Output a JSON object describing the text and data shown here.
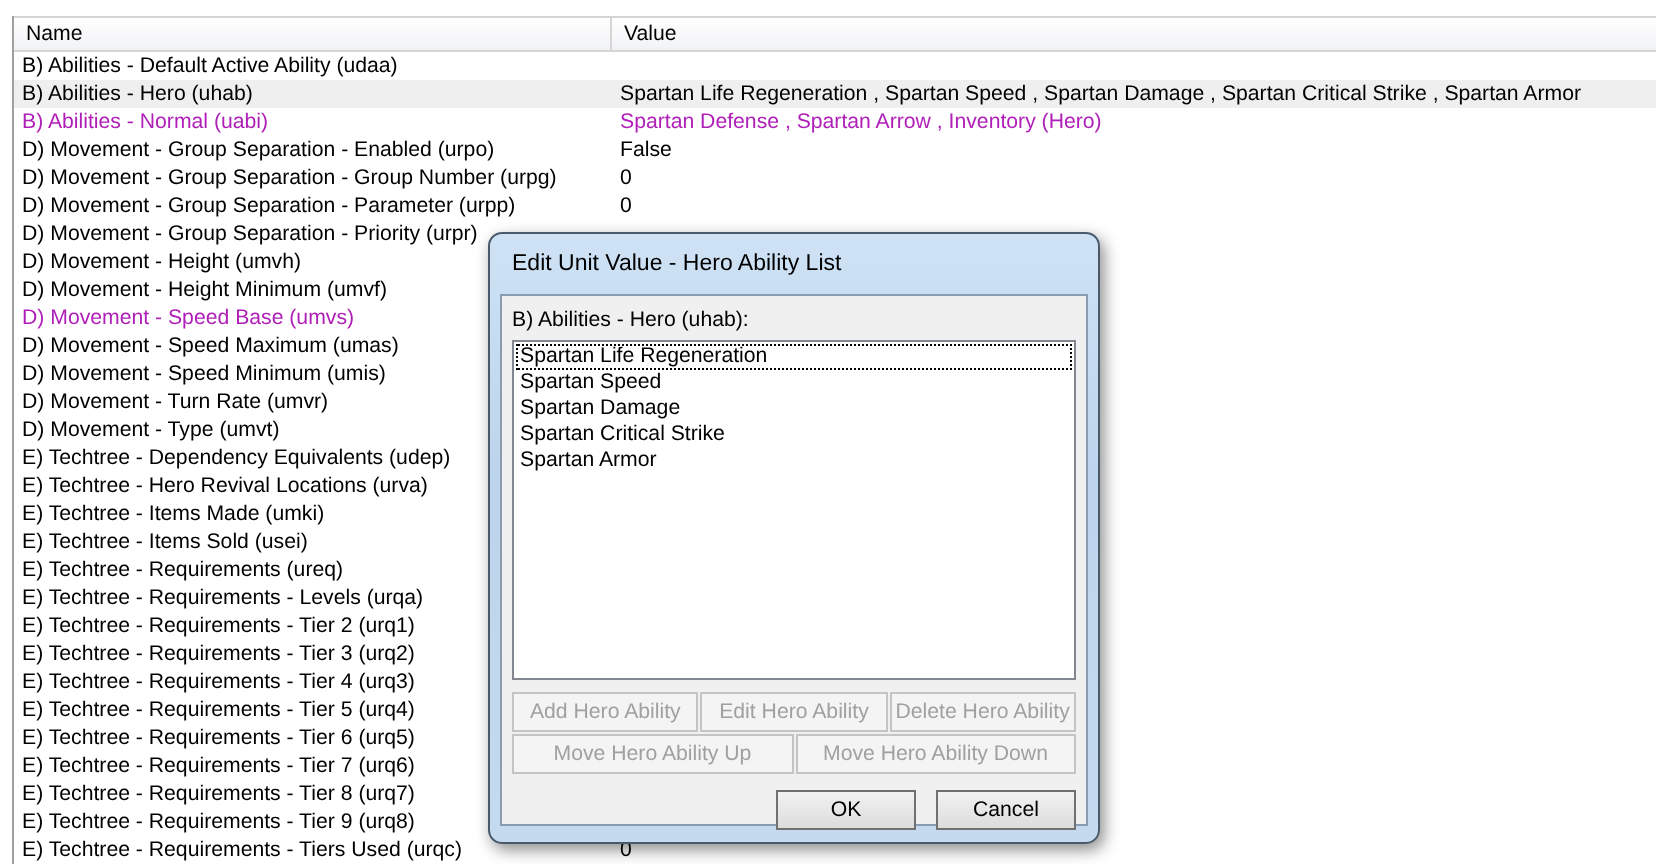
{
  "table": {
    "columns": [
      "Name",
      "Value"
    ],
    "rows": [
      {
        "name": "B) Abilities - Default Active Ability (udaa)",
        "selected": false,
        "modified": false
      },
      {
        "name": "B) Abilities - Hero (uhab)",
        "value": "Spartan Life Regeneration , Spartan Speed , Spartan Damage , Spartan Critical Strike , Spartan Armor",
        "selected": true,
        "modified": false
      },
      {
        "name": "B) Abilities - Normal (uabi)",
        "value": "Spartan Defense , Spartan Arrow , Inventory (Hero)",
        "selected": false,
        "modified": true
      },
      {
        "name": "D) Movement - Group Separation - Enabled (urpo)",
        "value": "False",
        "selected": false,
        "modified": false
      },
      {
        "name": "D) Movement - Group Separation - Group Number (urpg)",
        "value": "0",
        "selected": false,
        "modified": false
      },
      {
        "name": "D) Movement - Group Separation - Parameter (urpp)",
        "value": "0",
        "selected": false,
        "modified": false
      },
      {
        "name": "D) Movement - Group Separation - Priority (urpr)",
        "selected": false,
        "modified": false
      },
      {
        "name": "D) Movement - Height (umvh)",
        "selected": false,
        "modified": false
      },
      {
        "name": "D) Movement - Height Minimum (umvf)",
        "selected": false,
        "modified": false
      },
      {
        "name": "D) Movement - Speed Base (umvs)",
        "selected": false,
        "modified": true
      },
      {
        "name": "D) Movement - Speed Maximum (umas)",
        "selected": false,
        "modified": false
      },
      {
        "name": "D) Movement - Speed Minimum (umis)",
        "selected": false,
        "modified": false
      },
      {
        "name": "D) Movement - Turn Rate (umvr)",
        "selected": false,
        "modified": false
      },
      {
        "name": "D) Movement - Type (umvt)",
        "selected": false,
        "modified": false
      },
      {
        "name": "E) Techtree - Dependency Equivalents (udep)",
        "selected": false,
        "modified": false
      },
      {
        "name": "E) Techtree - Hero Revival Locations (urva)",
        "selected": false,
        "modified": false
      },
      {
        "name": "E) Techtree - Items Made (umki)",
        "selected": false,
        "modified": false
      },
      {
        "name": "E) Techtree - Items Sold (usei)",
        "selected": false,
        "modified": false
      },
      {
        "name": "E) Techtree - Requirements (ureq)",
        "selected": false,
        "modified": false
      },
      {
        "name": "E) Techtree - Requirements - Levels (urqa)",
        "selected": false,
        "modified": false
      },
      {
        "name": "E) Techtree - Requirements - Tier 2 (urq1)",
        "selected": false,
        "modified": false
      },
      {
        "name": "E) Techtree - Requirements - Tier 3 (urq2)",
        "selected": false,
        "modified": false
      },
      {
        "name": "E) Techtree - Requirements - Tier 4 (urq3)",
        "selected": false,
        "modified": false
      },
      {
        "name": "E) Techtree - Requirements - Tier 5 (urq4)",
        "selected": false,
        "modified": false
      },
      {
        "name": "E) Techtree - Requirements - Tier 6 (urq5)",
        "selected": false,
        "modified": false
      },
      {
        "name": "E) Techtree - Requirements - Tier 7 (urq6)",
        "selected": false,
        "modified": false
      },
      {
        "name": "E) Techtree - Requirements - Tier 8 (urq7)",
        "selected": false,
        "modified": false
      },
      {
        "name": "E) Techtree - Requirements - Tier 9 (urq8)",
        "selected": false,
        "modified": false
      },
      {
        "name": "E) Techtree - Requirements - Tiers Used (urqc)",
        "value": "0",
        "selected": false,
        "modified": false
      }
    ]
  },
  "dialog": {
    "title": "Edit Unit Value - Hero Ability List",
    "label": "B) Abilities - Hero (uhab):",
    "items": [
      {
        "text": "Spartan Life Regeneration",
        "focused": true
      },
      {
        "text": "Spartan Speed",
        "focused": false
      },
      {
        "text": "Spartan Damage",
        "focused": false
      },
      {
        "text": "Spartan Critical Strike",
        "focused": false
      },
      {
        "text": "Spartan Armor",
        "focused": false
      }
    ],
    "button_rows": [
      [
        {
          "label": "Add Hero Ability",
          "disabled": true
        },
        {
          "label": "Edit Hero Ability",
          "disabled": true
        },
        {
          "label": "Delete Hero Ability",
          "disabled": true
        }
      ],
      [
        {
          "label": "Move Hero Ability Up",
          "disabled": true
        },
        {
          "label": "Move Hero Ability Down",
          "disabled": true
        }
      ]
    ],
    "ok": {
      "label": "OK"
    },
    "cancel": {
      "label": "Cancel"
    }
  }
}
